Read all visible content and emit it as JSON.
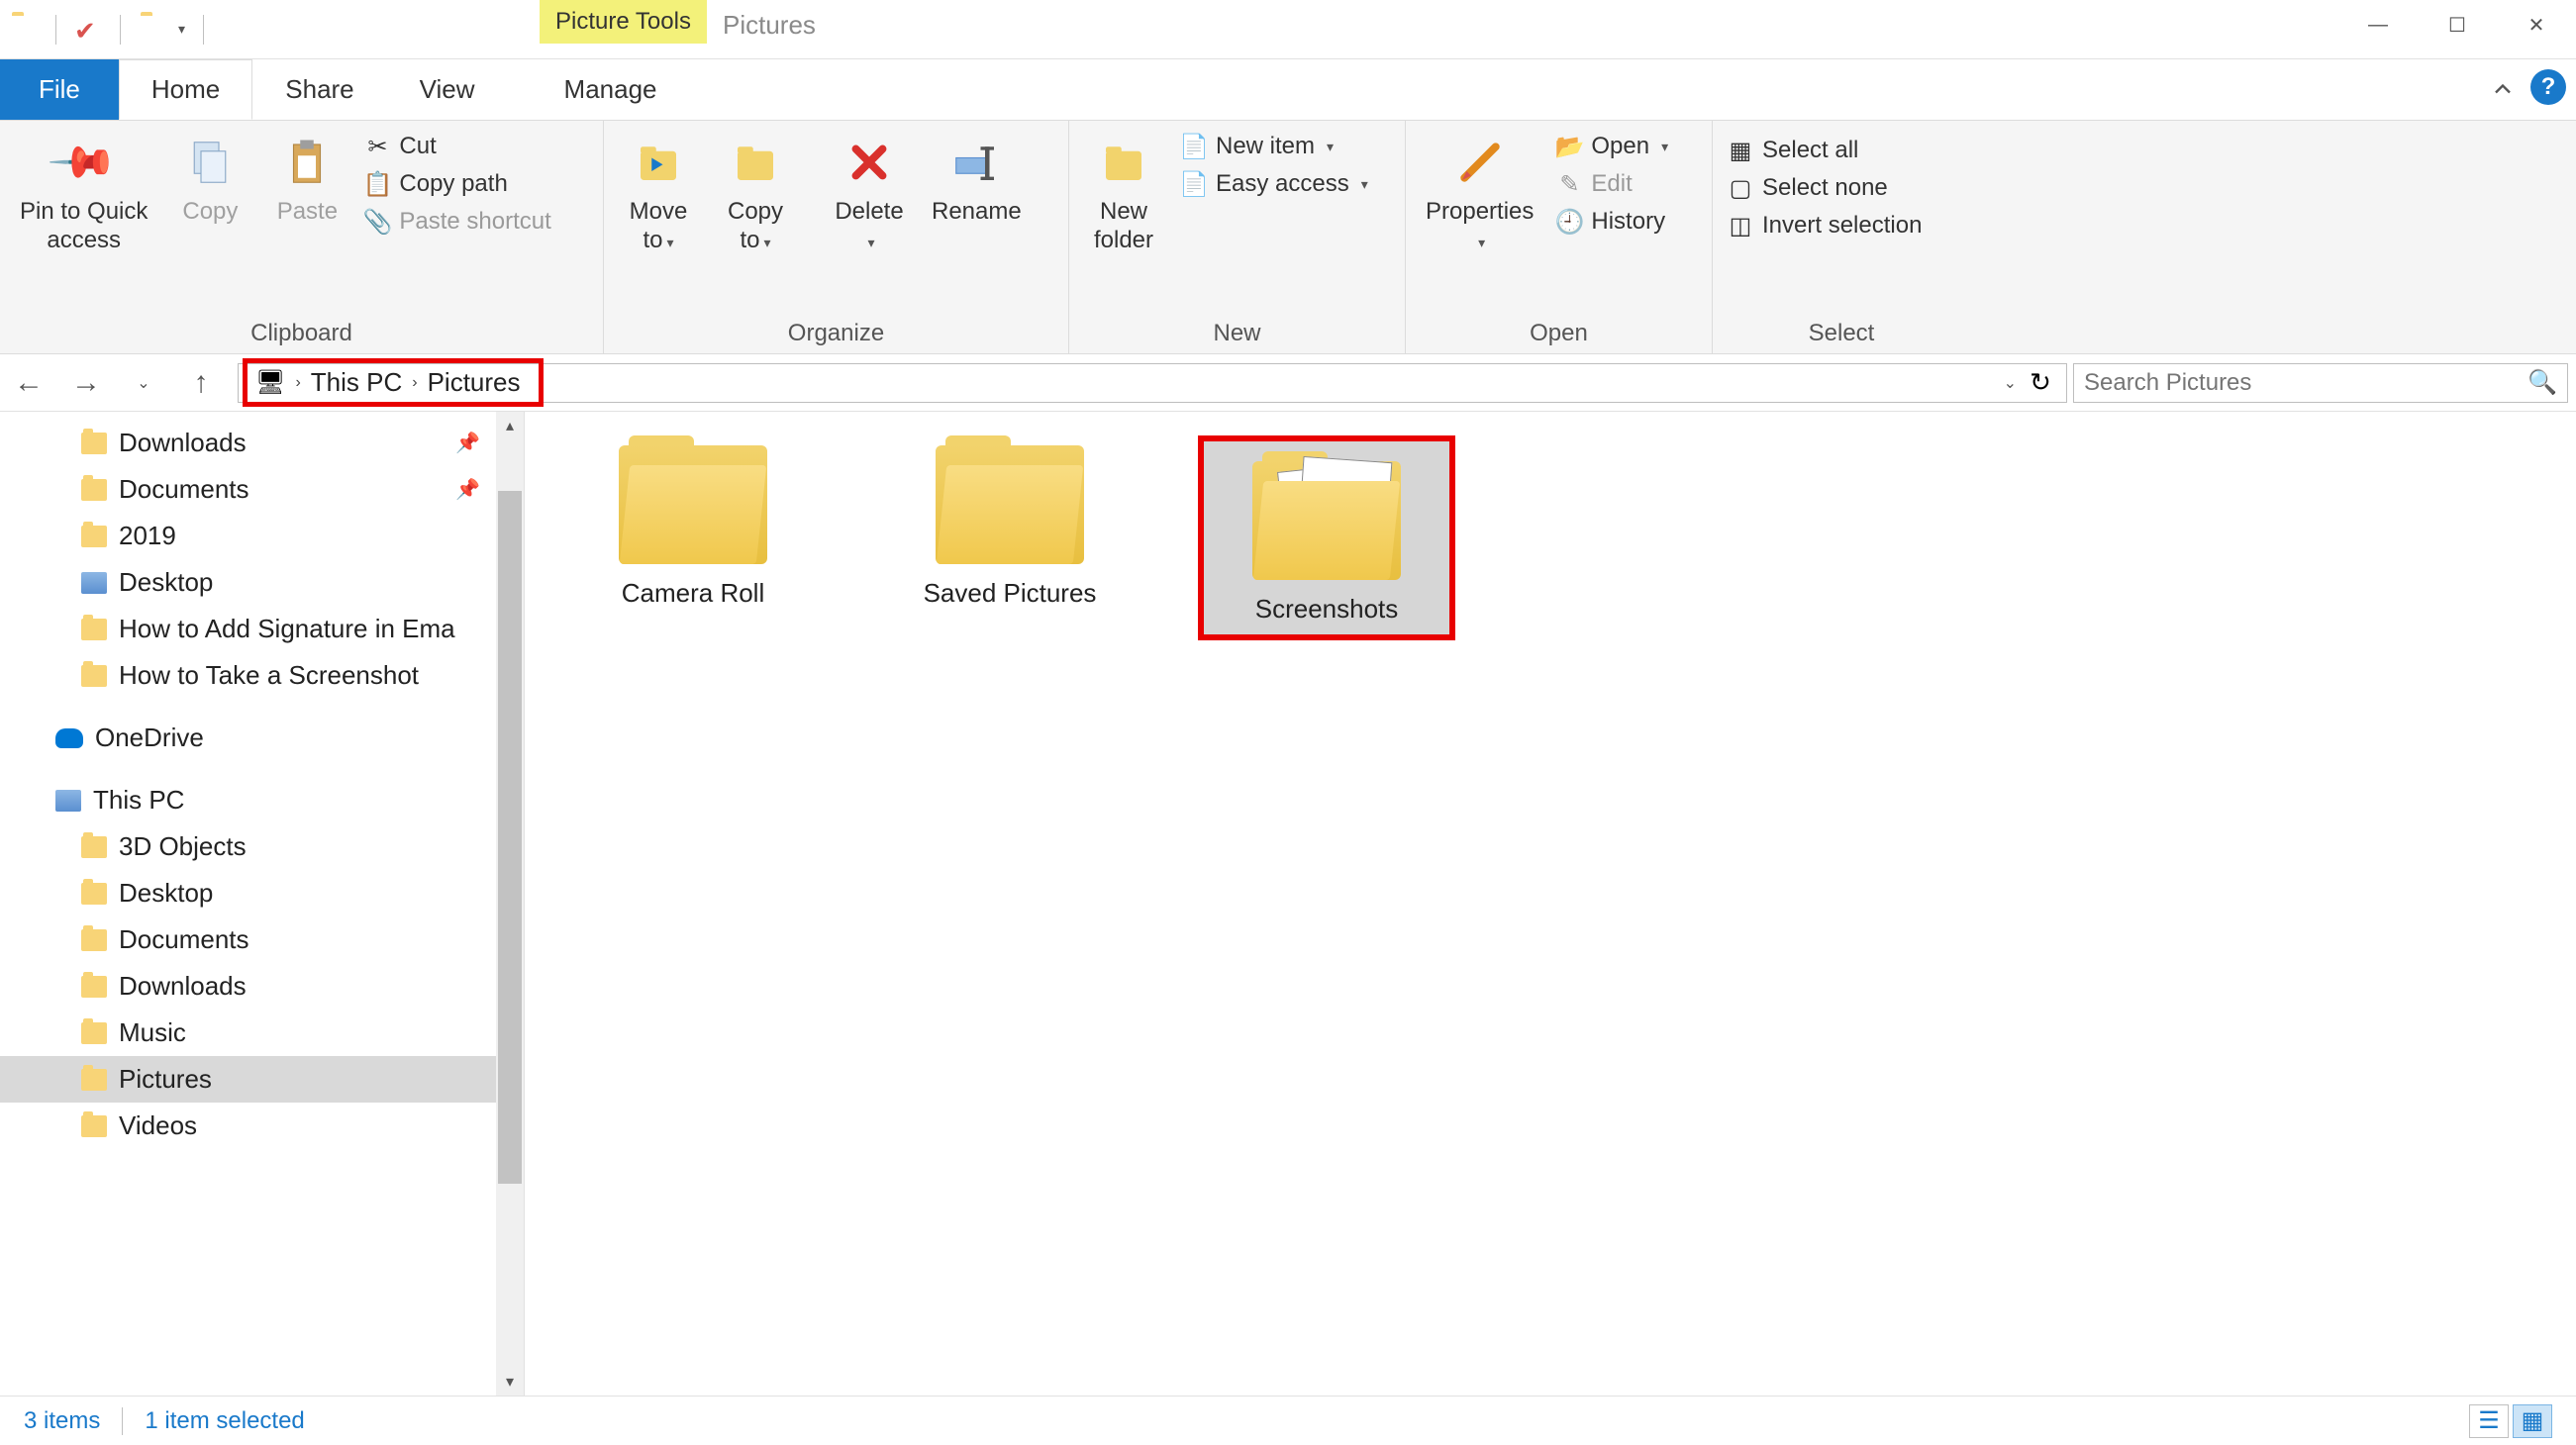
{
  "titlebar": {
    "picture_tools": "Picture Tools",
    "title": "Pictures"
  },
  "tabs": {
    "file": "File",
    "home": "Home",
    "share": "Share",
    "view": "View",
    "manage": "Manage"
  },
  "ribbon": {
    "clipboard": {
      "label": "Clipboard",
      "pin": "Pin to Quick\naccess",
      "copy": "Copy",
      "paste": "Paste",
      "cut": "Cut",
      "copy_path": "Copy path",
      "paste_shortcut": "Paste shortcut"
    },
    "organize": {
      "label": "Organize",
      "move_to": "Move\nto",
      "copy_to": "Copy\nto",
      "delete": "Delete",
      "rename": "Rename"
    },
    "new": {
      "label": "New",
      "new_folder": "New\nfolder",
      "new_item": "New item",
      "easy_access": "Easy access"
    },
    "open": {
      "label": "Open",
      "properties": "Properties",
      "open": "Open",
      "edit": "Edit",
      "history": "History"
    },
    "select": {
      "label": "Select",
      "select_all": "Select all",
      "select_none": "Select none",
      "invert": "Invert selection"
    }
  },
  "address": {
    "this_pc": "This PC",
    "pictures": "Pictures",
    "search_placeholder": "Search Pictures"
  },
  "tree": {
    "downloads": "Downloads",
    "documents": "Documents",
    "y2019": "2019",
    "desktop": "Desktop",
    "howto_sig": "How to Add Signature in Ema",
    "howto_ss": "How to Take a Screenshot",
    "onedrive": "OneDrive",
    "this_pc": "This PC",
    "objects3d": "3D Objects",
    "desktop2": "Desktop",
    "documents2": "Documents",
    "downloads2": "Downloads",
    "music": "Music",
    "pictures": "Pictures",
    "videos": "Videos"
  },
  "items": {
    "camera_roll": "Camera Roll",
    "saved_pictures": "Saved Pictures",
    "screenshots": "Screenshots"
  },
  "status": {
    "count": "3 items",
    "selected": "1 item selected"
  }
}
